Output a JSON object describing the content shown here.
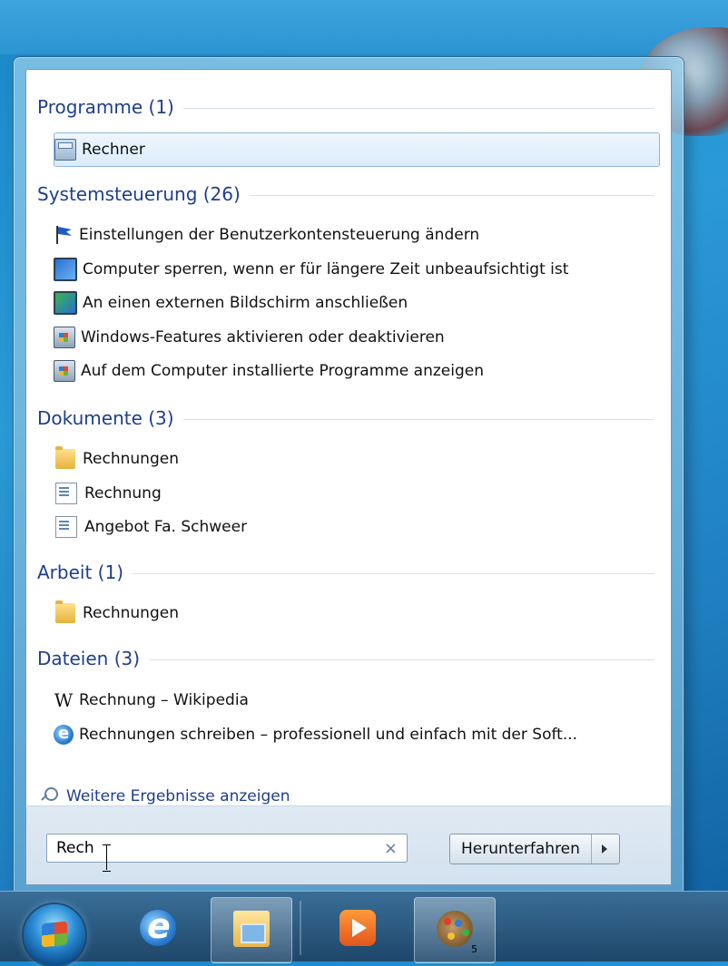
{
  "sections": [
    {
      "title": "Programme (1)",
      "items": [
        {
          "label": "Rechner",
          "icon": "calculator-icon",
          "selected": true
        }
      ]
    },
    {
      "title": "Systemsteuerung (26)",
      "items": [
        {
          "label": "Einstellungen der Benutzerkontensteuerung ändern",
          "icon": "uac-flag-icon"
        },
        {
          "label": "Computer sperren, wenn er für längere Zeit unbeaufsichtigt ist",
          "icon": "monitor-icon"
        },
        {
          "label": "An einen externen Bildschirm anschließen",
          "icon": "display-icon"
        },
        {
          "label": "Windows-Features aktivieren oder deaktivieren",
          "icon": "programs-icon"
        },
        {
          "label": "Auf dem Computer installierte Programme anzeigen",
          "icon": "programs-icon"
        }
      ]
    },
    {
      "title": "Dokumente (3)",
      "items": [
        {
          "label": "Rechnungen",
          "icon": "folder-icon"
        },
        {
          "label": "Rechnung",
          "icon": "document-icon"
        },
        {
          "label": "Angebot Fa. Schweer",
          "icon": "document-icon"
        }
      ]
    },
    {
      "title": "Arbeit (1)",
      "items": [
        {
          "label": "Rechnungen",
          "icon": "folder-icon"
        }
      ]
    },
    {
      "title": "Dateien (3)",
      "items": [
        {
          "label": "Rechnung – Wikipedia",
          "icon": "wikipedia-icon"
        },
        {
          "label": "Rechnungen schreiben – professionell und einfach mit der Soft...",
          "icon": "internet-explorer-icon"
        }
      ]
    }
  ],
  "more_results": "Weitere Ergebnisse anzeigen",
  "search": {
    "value": "Rech",
    "clear_label": "×"
  },
  "shutdown": {
    "label": "Herunterfahren"
  },
  "taskbar": {
    "items": [
      "start-orb",
      "internet-explorer",
      "windows-explorer",
      "media-player",
      "paint"
    ],
    "paint_badge": "5"
  },
  "colors": {
    "section_title": "#1e3f8c",
    "selected_bg": "#dcecfc",
    "taskbar": "#1e4669"
  }
}
